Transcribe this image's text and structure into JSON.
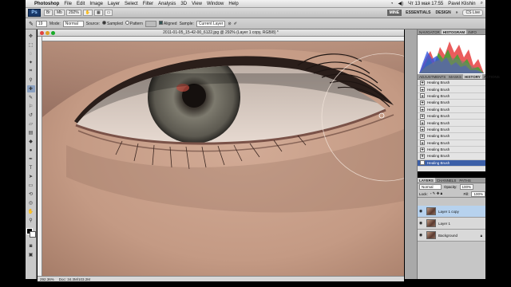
{
  "menubar": {
    "apple": "",
    "app_name": "Photoshop",
    "items": [
      "File",
      "Edit",
      "Image",
      "Layer",
      "Select",
      "Filter",
      "Analysis",
      "3D",
      "View",
      "Window",
      "Help"
    ],
    "clock": "Чт 13 мая  17:55",
    "user": "Pavel Klishin"
  },
  "appbar": {
    "logo": "Ps",
    "zoom": "292%",
    "workspace_mine": "MINE",
    "workspaces": [
      "ESSENTIALS",
      "DESIGN"
    ],
    "more": "»",
    "cs_live": "CS Live"
  },
  "options": {
    "mode_label": "Mode:",
    "mode_value": "Normal",
    "source_label": "Source:",
    "source_sampled": "Sampled",
    "source_pattern": "Pattern",
    "aligned_label": "Aligned",
    "sample_label": "Sample:",
    "sample_value": "Current Layer"
  },
  "document": {
    "title": "2011-01-05_15-42-00_6122.jpg @ 292% (Layer 1 copy, RGB/8) *",
    "status_zoom": "292.36%",
    "status_doc": "Doc: 34.3M/103.2M"
  },
  "panels": {
    "top_tabs": [
      "NAVIGATOR",
      "HISTOGRAM",
      "INFO"
    ],
    "mid_tabs": [
      "ADJUSTMENTS",
      "MASKS",
      "HISTORY",
      "ACTIONS"
    ],
    "history_items": [
      "Healing Brush",
      "Healing Brush",
      "Healing Brush",
      "Healing Brush",
      "Healing Brush",
      "Healing Brush",
      "Healing Brush",
      "Healing Brush",
      "Healing Brush",
      "Healing Brush",
      "Healing Brush",
      "Healing Brush",
      "Healing Brush"
    ],
    "layer_tabs": [
      "LAYERS",
      "CHANNELS",
      "PATHS"
    ],
    "blend_mode": "Normal",
    "opacity_label": "Opacity:",
    "opacity_value": "100%",
    "lock_label": "Lock:",
    "fill_label": "Fill:",
    "fill_value": "100%",
    "layers": [
      {
        "name": "Layer 1 copy",
        "selected": true
      },
      {
        "name": "Layer 1",
        "selected": false
      },
      {
        "name": "Background",
        "selected": false
      }
    ]
  },
  "colors": {
    "selection_blue": "#3b5fa8",
    "layer_selected": "#b7d2ee",
    "skin": "#c9a08a"
  }
}
